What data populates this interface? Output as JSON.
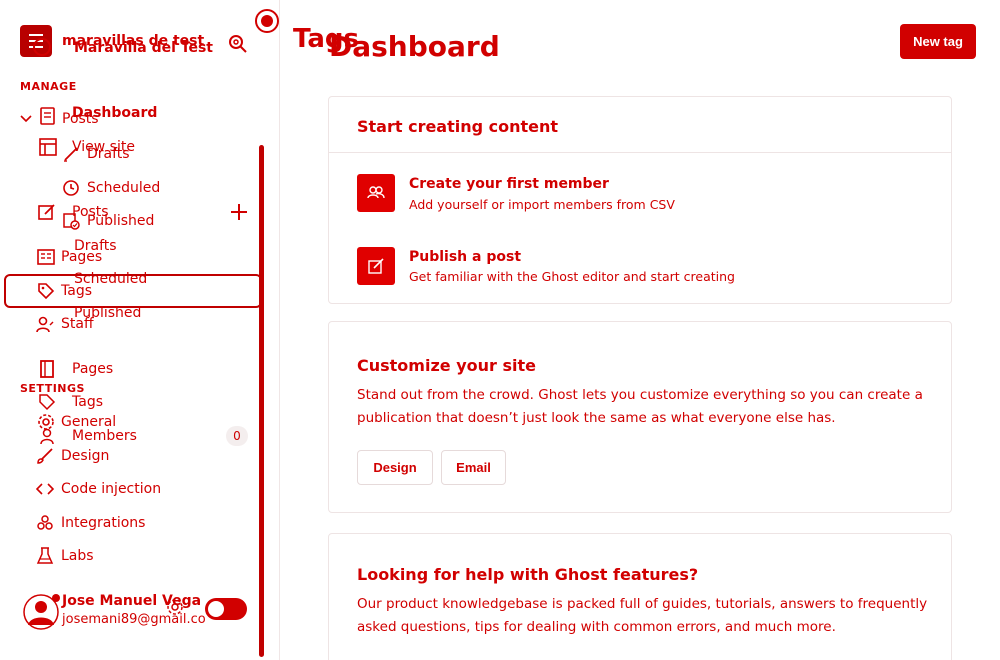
{
  "site": {
    "name_primary": "maravillas de test",
    "name_secondary": "Maravilla del Test"
  },
  "sidebar": {
    "manage_label": "MANAGE",
    "settings_label": "SETTINGS",
    "posts_group": {
      "label": "Posts",
      "children": [
        "Drafts",
        "Scheduled",
        "Published"
      ]
    },
    "ghost_items": {
      "dashboard": "Dashboard",
      "view_site": "View site",
      "posts": "Posts",
      "drafts": "Drafts",
      "scheduled": "Scheduled",
      "published": "Published",
      "pages": "Pages",
      "tags": "Tags",
      "members": "Members",
      "members_count": "0"
    },
    "items": {
      "pages": "Pages",
      "tags": "Tags",
      "staff": "Staff"
    },
    "settings_items": [
      "General",
      "Design",
      "Code injection",
      "Integrations",
      "Labs"
    ]
  },
  "user": {
    "name": "Jose Manuel Vega",
    "email": "josemani89@gmail.co"
  },
  "header": {
    "title_underlay": "Tags",
    "title": "Dashboard",
    "new_tag_label": "New tag"
  },
  "cards": {
    "start": {
      "title": "Start creating content",
      "rows": [
        {
          "title": "Create your first member",
          "subtitle": "Add yourself or import members from CSV",
          "icon": "members-icon"
        },
        {
          "title": "Publish a post",
          "subtitle": "Get familiar with the Ghost editor and start creating",
          "icon": "edit-post-icon"
        }
      ]
    },
    "customize": {
      "title": "Customize your site",
      "text": "Stand out from the crowd. Ghost lets you customize everything so you can create a publication that doesn’t just look the same as what everyone else has.",
      "buttons": [
        "Design",
        "Email"
      ]
    },
    "help": {
      "title": "Looking for help with Ghost features?",
      "text": "Our product knowledgebase is packed full of guides, tutorials, answers to frequently asked questions, tips for dealing with common errors, and much more."
    }
  },
  "colors": {
    "accent": "#d10000",
    "border": "#eee4e4"
  }
}
